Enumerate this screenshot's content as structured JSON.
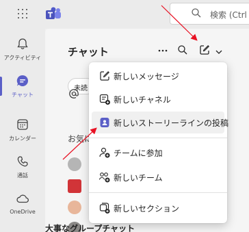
{
  "topbar": {
    "search_placeholder": "検索 (Ctrl"
  },
  "rail": {
    "items": [
      {
        "label": "アクティビティ",
        "icon": "bell-icon"
      },
      {
        "label": "チャット",
        "icon": "chat-icon",
        "active": true
      },
      {
        "label": "カレンダー",
        "icon": "calendar-icon"
      },
      {
        "label": "通話",
        "icon": "phone-icon"
      },
      {
        "label": "OneDrive",
        "icon": "cloud-icon"
      }
    ]
  },
  "pane": {
    "title": "チャット",
    "filter_label": "未読",
    "section_label": "お気に入り",
    "last_chat_label": "大事なグループチャット"
  },
  "menu": {
    "items": [
      {
        "label": "新しいメッセージ",
        "icon": "compose-icon"
      },
      {
        "label": "新しいチャネル",
        "icon": "channel-add-icon"
      },
      {
        "label": "新しいストーリーラインの投稿",
        "icon": "storyline-icon",
        "highlighted": true
      },
      {
        "label": "チームに参加",
        "icon": "person-add-icon"
      },
      {
        "label": "新しいチーム",
        "icon": "people-add-icon"
      },
      {
        "label": "新しいセクション",
        "icon": "section-add-icon"
      }
    ]
  },
  "colors": {
    "accent": "#5b5fc7",
    "annotation_arrow": "#e81123"
  }
}
